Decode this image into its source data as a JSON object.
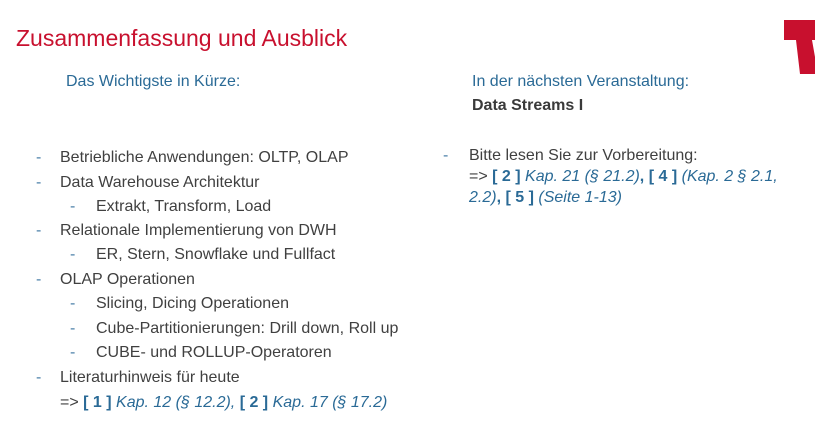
{
  "title": "Zusammenfassung und Ausblick",
  "left": {
    "heading": "Das Wichtigste in Kürze:",
    "items": [
      "Betriebliche Anwendungen: OLTP, OLAP",
      "Data Warehouse Architektur",
      "Extrakt, Transform, Load",
      "Relationale Implementierung von DWH",
      "ER, Stern, Snowflake und Fullfact",
      "OLAP Operationen",
      "Slicing, Dicing Operationen",
      "Cube-Partitionierungen: Drill down, Roll up",
      "CUBE- und ROLLUP-Operatoren",
      "Literaturhinweis für heute"
    ],
    "lit_refs": {
      "arrow": "=>",
      "ref1": "[ 1 ]",
      "ref1_detail": "Kap. 12 (§ 12.2),",
      "ref2": "[ 2 ]",
      "ref2_detail": "Kap. 17 (§ 17.2)"
    }
  },
  "right": {
    "heading": "In der nächsten Veranstaltung:",
    "topic": "Data Streams I",
    "item": "Bitte lesen Sie zur Vorbereitung:",
    "refs": {
      "arrow": "=>",
      "ref2": "[ 2 ]",
      "ref2_detail": "Kap. 21 (§ 21.2)",
      "comma1": ",",
      "ref4": "[ 4 ]",
      "ref4_detail": "(Kap. 2 § 2.1,",
      "ref4_detail2": "2.2)",
      "comma2": ",",
      "ref5": "[ 5 ]",
      "ref5_detail": "(Seite 1-13)"
    }
  },
  "bullet": "-",
  "colors": {
    "title": "#c8102e",
    "accent": "#2a6a96",
    "text": "#404040"
  },
  "logo_icon": "university-logo-icon"
}
